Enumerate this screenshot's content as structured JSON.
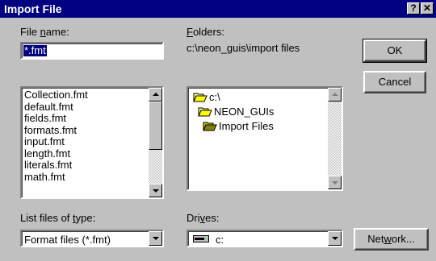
{
  "window": {
    "title": "Import File",
    "help_label": "?",
    "close_label": "✕"
  },
  "file_name": {
    "label_pre": "File ",
    "label_accel": "n",
    "label_post": "ame:",
    "value": "*.fmt",
    "files": [
      "Collection.fmt",
      "default.fmt",
      "fields.fmt",
      "formats.fmt",
      "input.fmt",
      "length.fmt",
      "literals.fmt",
      "math.fmt"
    ]
  },
  "folders": {
    "label_accel": "F",
    "label_post": "olders:",
    "path": "c:\\neon_guis\\import files",
    "tree": [
      {
        "name": "c:\\",
        "icon": "open-folder-icon"
      },
      {
        "name": "NEON_GUIs",
        "icon": "open-folder-icon"
      },
      {
        "name": "Import Files",
        "icon": "open-folder-selected-icon"
      }
    ]
  },
  "file_type": {
    "label_pre": "List files of ",
    "label_accel": "t",
    "label_post": "ype:",
    "selected": "Format files (*.fmt)"
  },
  "drives": {
    "label_pre": "Dri",
    "label_accel": "v",
    "label_post": "es:",
    "selected": "c:",
    "icon": "hard-drive-icon"
  },
  "buttons": {
    "ok": "OK",
    "cancel": "Cancel",
    "network_pre": "Net",
    "network_accel": "w",
    "network_post": "ork..."
  }
}
